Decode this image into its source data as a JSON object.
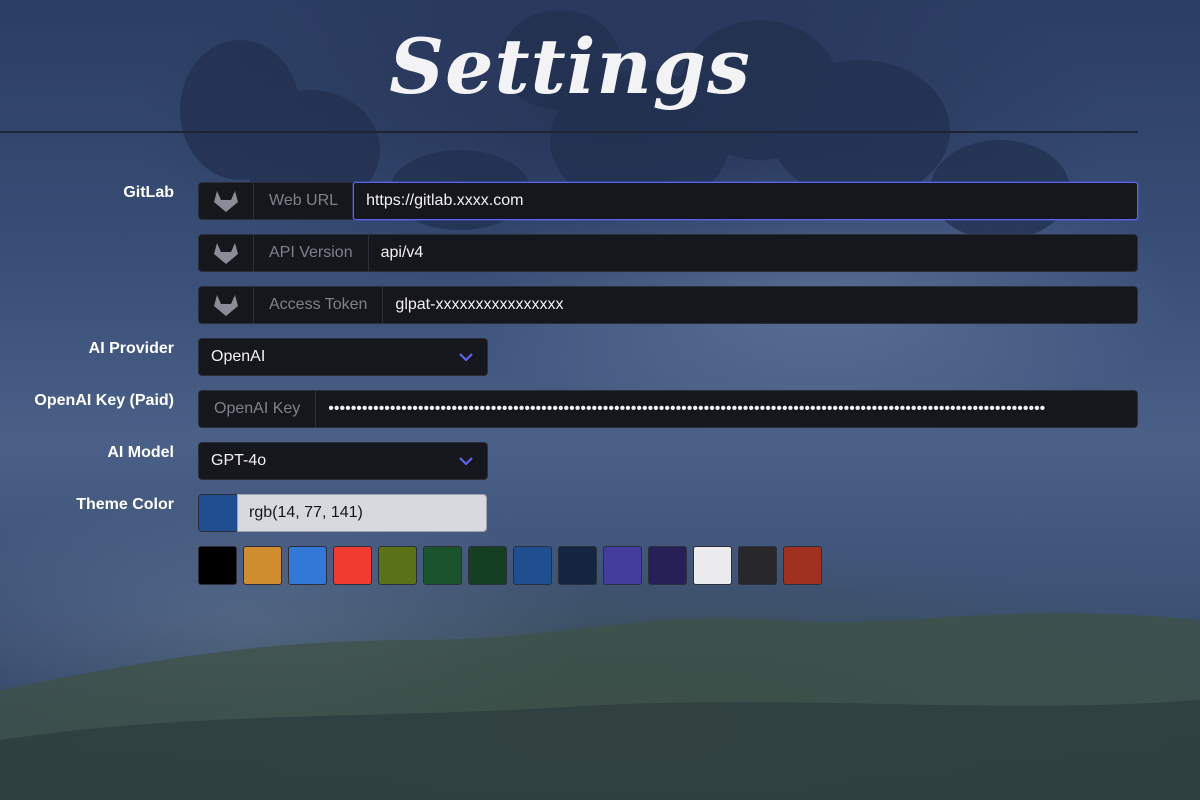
{
  "title": "Settings",
  "gitlab": {
    "label": "GitLab",
    "web_url": {
      "addon": "Web URL",
      "value": "https://gitlab.xxxx.com"
    },
    "api_version": {
      "addon": "API Version",
      "value": "api/v4"
    },
    "access_token": {
      "addon": "Access Token",
      "value": "glpat-xxxxxxxxxxxxxxxx"
    }
  },
  "ai_provider": {
    "label": "AI Provider",
    "selected": "OpenAI"
  },
  "openai_key": {
    "label": "OpenAI Key (Paid)",
    "addon": "OpenAI Key",
    "masked_value": "••••••••••••••••••••••••••••••••••••••••••••••••••••••••••••••••••••••••••••••••••••••••••••••••••••••••••••••••••••••••••••••••"
  },
  "ai_model": {
    "label": "AI Model",
    "selected": "GPT-4o"
  },
  "theme_color": {
    "label": "Theme Color",
    "value": "rgb(14, 77, 141)",
    "current_hex": "#1f4f8e",
    "swatches": [
      "#000000",
      "#d08d2f",
      "#3378d6",
      "#f23b30",
      "#5a7318",
      "#1a532e",
      "#153f23",
      "#1f4f8e",
      "#132541",
      "#433d9e",
      "#252156",
      "#ececee",
      "#27272c",
      "#a0301f"
    ]
  },
  "accent_color": "#5a63f0"
}
